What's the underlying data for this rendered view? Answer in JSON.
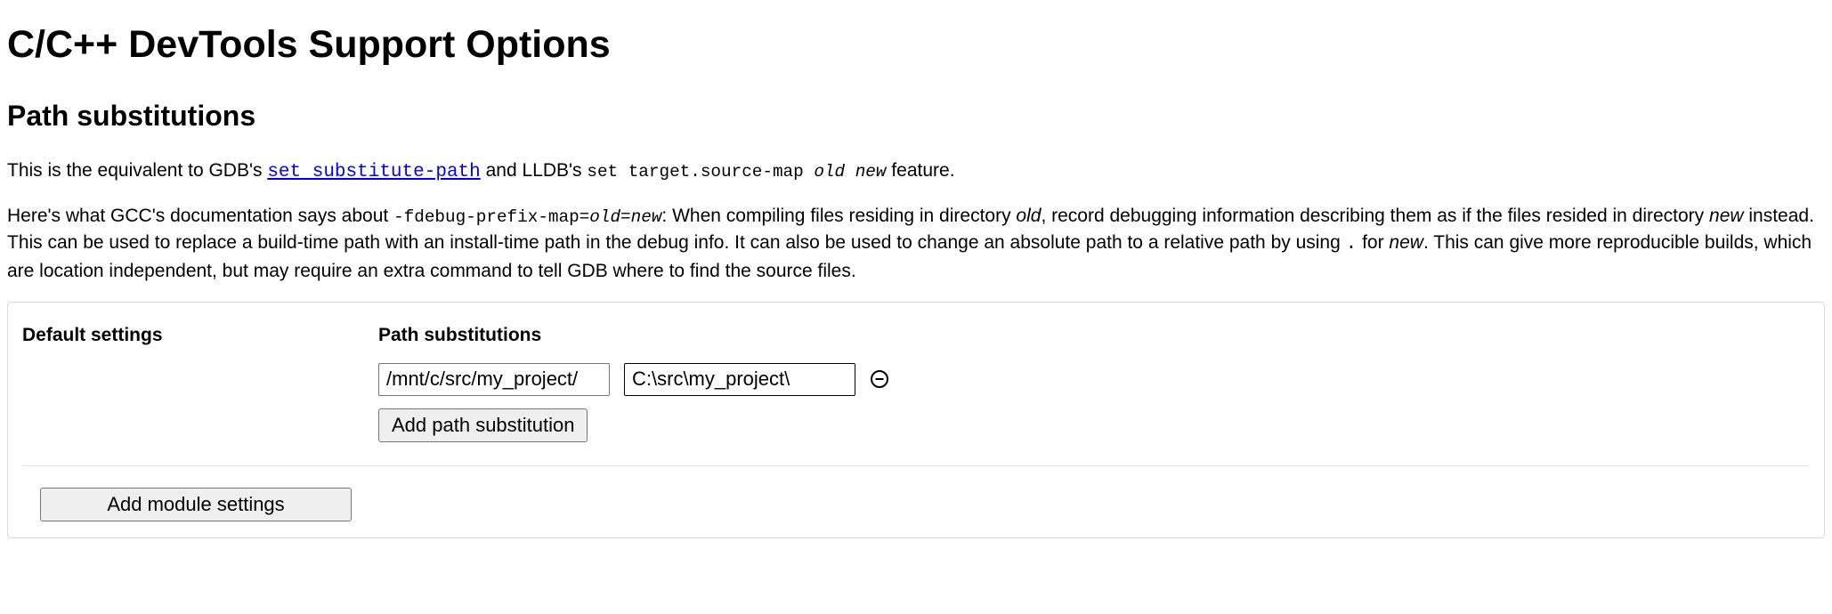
{
  "title": "C/C++ DevTools Support Options",
  "section_heading": "Path substitutions",
  "para1": {
    "prefix": "This is the equivalent to GDB's ",
    "link_text": "set substitute-path",
    "mid": " and LLDB's ",
    "code2_a": "set target.source-map ",
    "code2_old": "old",
    "code2_space": " ",
    "code2_new": "new",
    "suffix": " feature."
  },
  "para2": {
    "a": "Here's what GCC's documentation says about ",
    "flag_a": "-fdebug-prefix-map=",
    "flag_old": "old",
    "flag_eq": "=",
    "flag_new": "new",
    "b": ": When compiling files residing in directory ",
    "old1": "old",
    "c": ", record debugging information describing them as if the files resided in directory ",
    "new1": "new",
    "d": " instead. This can be used to replace a build-time path with an install-time path in the debug info. It can also be used to change an absolute path to a relative path by using ",
    "dot": ".",
    "e": " for ",
    "new2": "new",
    "f": ". This can give more reproducible builds, which are location independent, but may require an extra command to tell GDB where to find the source files."
  },
  "settings": {
    "default_label": "Default settings",
    "path_sub_label": "Path substitutions",
    "row": {
      "from": "/mnt/c/src/my_project/",
      "to": "C:\\src\\my_project\\"
    },
    "add_path_btn": "Add path substitution",
    "add_module_btn": "Add module settings"
  }
}
